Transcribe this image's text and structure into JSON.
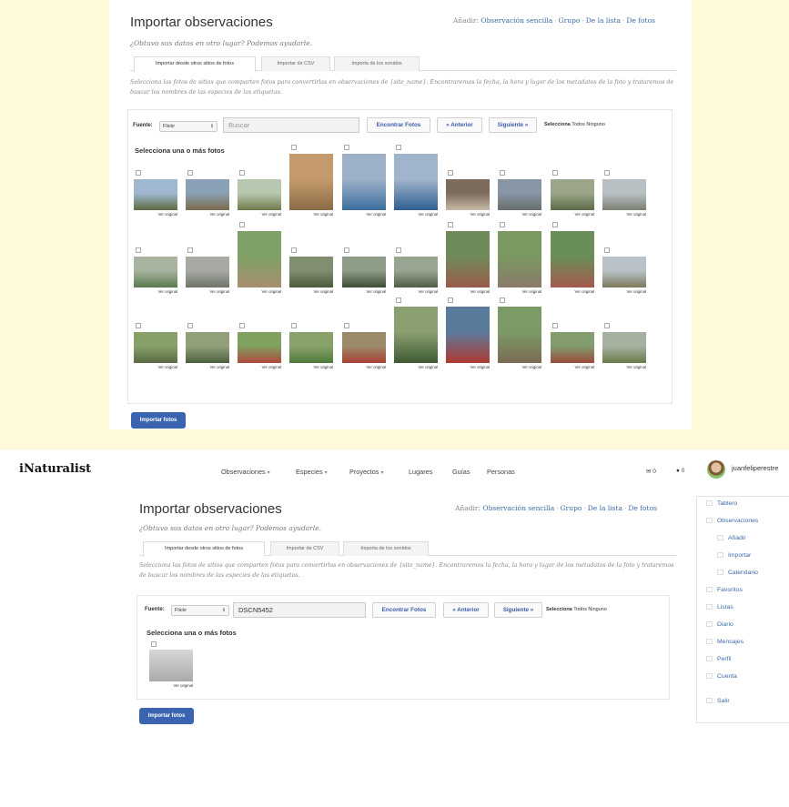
{
  "page_title": "Importar observaciones",
  "subtitle": "¿Obtuvo sus datos en otro lugar? Podemos ayudarle.",
  "add_label": "Añadir:",
  "add_links": [
    "Observación sencilla",
    "Grupo",
    "De la lista",
    "De fotos"
  ],
  "tabs": [
    "Importar desde otros sitios de fotos",
    "Importar de CSV",
    "Importa de los sonidos"
  ],
  "description": "Selecciona las fotos de sitios que comparten fotos para convertirlas en observaciones de {site_name}. Encontraremos la fecha, la hora y lugar de los metadatos de la foto y trataremos de buscar los nombres de las especies de las etiquetas.",
  "source_label": "Fuente:",
  "source_value": "Flickr",
  "search_placeholder": "Buscar",
  "search_value_bottom": "DSCN5452",
  "buttons": {
    "find": "Encontrar Fotos",
    "prev": "« Anterior",
    "next": "Siguiente »"
  },
  "select_label": "Selecciona",
  "select_all": "Todos",
  "select_none": "Ninguno",
  "photos_heading": "Selecciona una o más fotos",
  "view_original": "Ver original",
  "import_button": "Importar fotos",
  "photo_count_top": 30,
  "photo_count_bottom": 1,
  "header": {
    "logo": "iNaturalist",
    "nav": [
      "Observaciones",
      "Especies",
      "Proyectos",
      "Lugares",
      "Guías",
      "Personas"
    ],
    "mail_count": "0",
    "chat_count": "0",
    "username": "juanfeliperestre"
  },
  "sidebar": {
    "items": [
      "Tablero",
      "Observaciones",
      "Añadir",
      "Importar",
      "Calendario",
      "Favoritos",
      "Listas",
      "Diario",
      "Mensajes",
      "Perfil",
      "Cuenta",
      "Salir"
    ]
  },
  "icons": {
    "mail": "envelope-icon",
    "chat": "speech-bubble-icon",
    "chevron": "chevron-down-icon",
    "select_arrow": "updown-arrow-icon"
  },
  "colors": {
    "background": "#fef9d6",
    "link": "#3b6aa8",
    "button_text": "#3b5ba8",
    "import_button": "#3b64b0"
  }
}
